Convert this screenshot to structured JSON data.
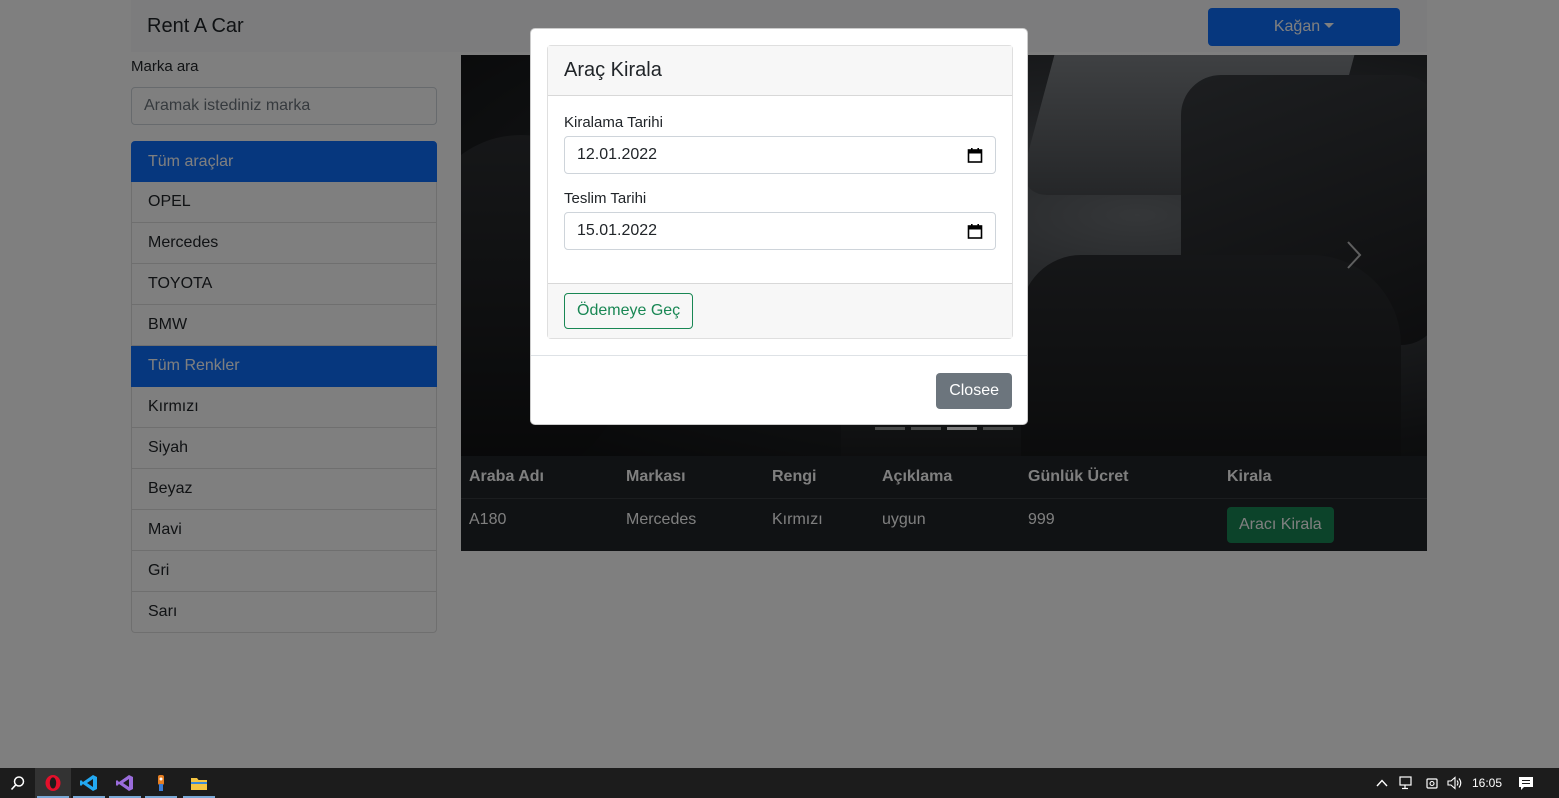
{
  "navbar": {
    "brand": "Rent A Car",
    "user_menu": "Kağan"
  },
  "sidebar": {
    "search_label": "Marka ara",
    "search_placeholder": "Aramak istediniz marka",
    "brands_header": "Tüm araçlar",
    "brands": [
      "OPEL",
      "Mercedes",
      "TOYOTA",
      "BMW"
    ],
    "colors_header": "Tüm Renkler",
    "colors": [
      "Kırmızı",
      "Siyah",
      "Beyaz",
      "Mavi",
      "Gri",
      "Sarı"
    ]
  },
  "carousel": {
    "indicator_count": 4,
    "active_indicator": 3
  },
  "table": {
    "headers": [
      "Araba Adı",
      "Markası",
      "Rengi",
      "Açıklama",
      "Günlük Ücret",
      "Kirala"
    ],
    "rows": [
      {
        "name": "A180",
        "brand": "Mercedes",
        "color": "Kırmızı",
        "description": "uygun",
        "daily_price": "999",
        "action": "Aracı Kirala"
      }
    ]
  },
  "modal": {
    "title": "Araç Kirala",
    "rent_date_label": "Kiralama Tarihi",
    "rent_date_value": "12.01.2022",
    "return_date_label": "Teslim Tarihi",
    "return_date_value": "15.01.2022",
    "pay_button": "Ödemeye Geç",
    "close_button": "Closee"
  },
  "taskbar": {
    "apps": [
      "search-icon",
      "opera-icon",
      "vscode-icon",
      "visual-studio-icon",
      "paint-icon",
      "file-explorer-icon"
    ],
    "clock": "16:05"
  }
}
